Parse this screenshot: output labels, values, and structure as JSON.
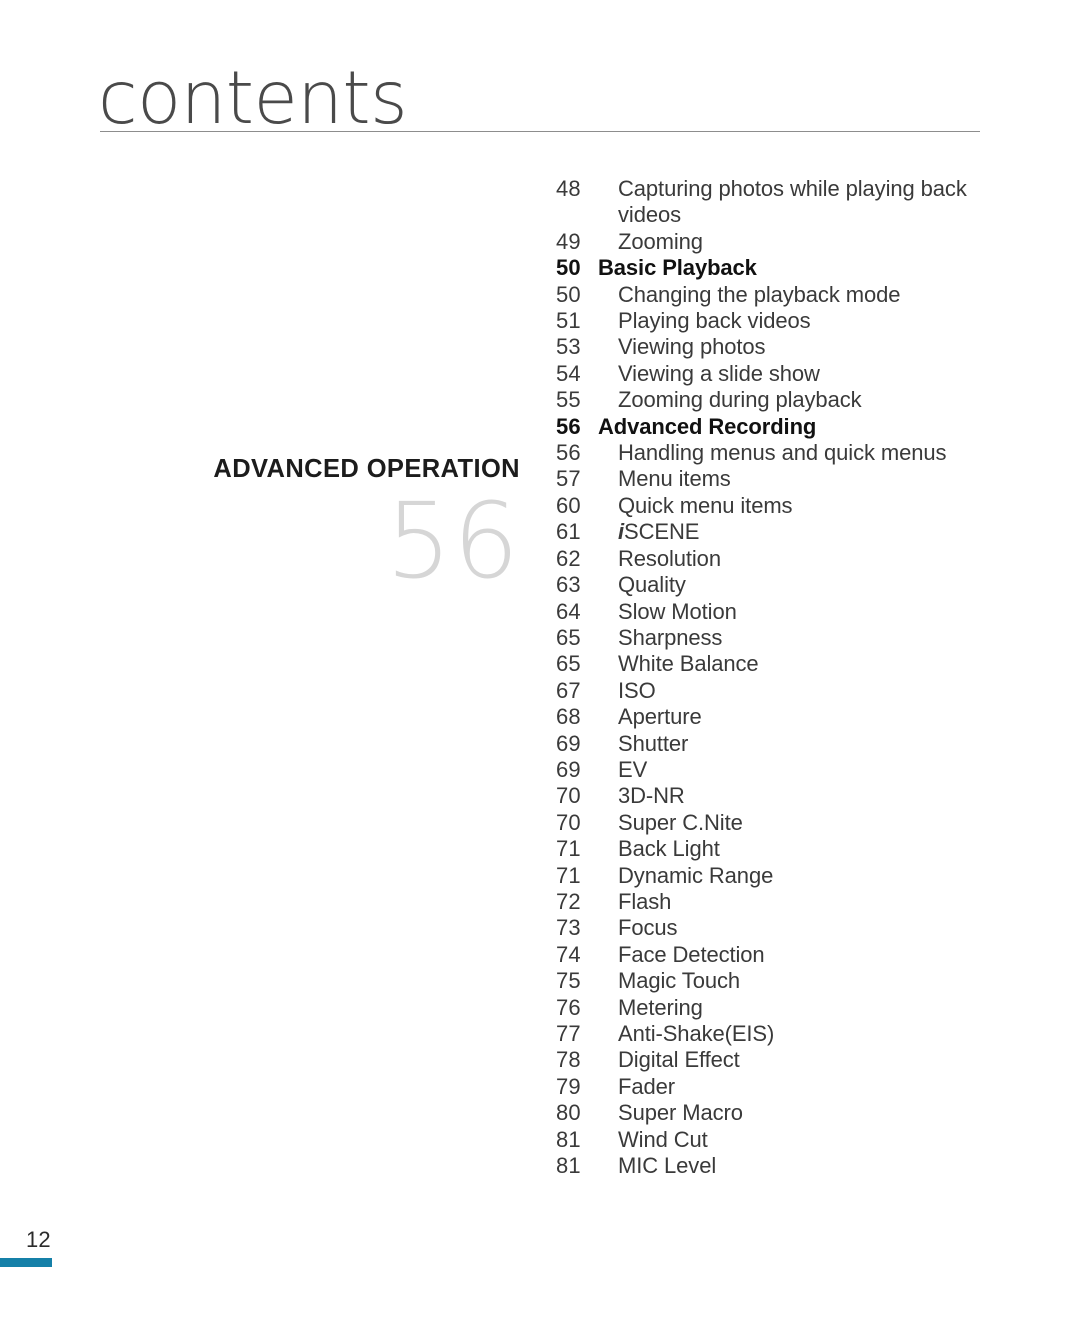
{
  "header": {
    "title": "contents"
  },
  "section": {
    "title": "ADVANCED OPERATION",
    "big_number": "56"
  },
  "footer": {
    "page_number": "12",
    "bar_color": "#1580a8"
  },
  "toc": {
    "entries": [
      {
        "num": "48",
        "label": "Capturing photos while playing back videos",
        "heading": false
      },
      {
        "num": "49",
        "label": "Zooming",
        "heading": false
      },
      {
        "num": "50",
        "label": "Basic Playback",
        "heading": true
      },
      {
        "num": "50",
        "label": "Changing the playback mode",
        "heading": false
      },
      {
        "num": "51",
        "label": "Playing back videos",
        "heading": false
      },
      {
        "num": "53",
        "label": "Viewing photos",
        "heading": false
      },
      {
        "num": "54",
        "label": "Viewing a slide show",
        "heading": false
      },
      {
        "num": "55",
        "label": "Zooming during playback",
        "heading": false
      },
      {
        "num": "56",
        "label": "Advanced Recording",
        "heading": true
      },
      {
        "num": "56",
        "label": "Handling menus and quick menus",
        "heading": false
      },
      {
        "num": "57",
        "label": "Menu items",
        "heading": false
      },
      {
        "num": "60",
        "label": "Quick menu items",
        "heading": false
      },
      {
        "num": "61",
        "label": "iSCENE",
        "heading": false,
        "italic_first": true
      },
      {
        "num": "62",
        "label": "Resolution",
        "heading": false
      },
      {
        "num": "63",
        "label": "Quality",
        "heading": false
      },
      {
        "num": "64",
        "label": "Slow Motion",
        "heading": false
      },
      {
        "num": "65",
        "label": "Sharpness",
        "heading": false
      },
      {
        "num": "65",
        "label": "White Balance",
        "heading": false
      },
      {
        "num": "67",
        "label": "ISO",
        "heading": false
      },
      {
        "num": "68",
        "label": "Aperture",
        "heading": false
      },
      {
        "num": "69",
        "label": "Shutter",
        "heading": false
      },
      {
        "num": "69",
        "label": "EV",
        "heading": false
      },
      {
        "num": "70",
        "label": "3D-NR",
        "heading": false
      },
      {
        "num": "70",
        "label": "Super C.Nite",
        "heading": false
      },
      {
        "num": "71",
        "label": "Back Light",
        "heading": false
      },
      {
        "num": "71",
        "label": "Dynamic Range",
        "heading": false
      },
      {
        "num": "72",
        "label": "Flash",
        "heading": false
      },
      {
        "num": "73",
        "label": "Focus",
        "heading": false
      },
      {
        "num": "74",
        "label": "Face Detection",
        "heading": false
      },
      {
        "num": "75",
        "label": "Magic Touch",
        "heading": false
      },
      {
        "num": "76",
        "label": "Metering",
        "heading": false
      },
      {
        "num": "77",
        "label": "Anti-Shake(EIS)",
        "heading": false
      },
      {
        "num": "78",
        "label": "Digital Effect",
        "heading": false
      },
      {
        "num": "79",
        "label": "Fader",
        "heading": false
      },
      {
        "num": "80",
        "label": "Super Macro",
        "heading": false
      },
      {
        "num": "81",
        "label": "Wind Cut",
        "heading": false
      },
      {
        "num": "81",
        "label": "MIC Level",
        "heading": false
      }
    ]
  }
}
